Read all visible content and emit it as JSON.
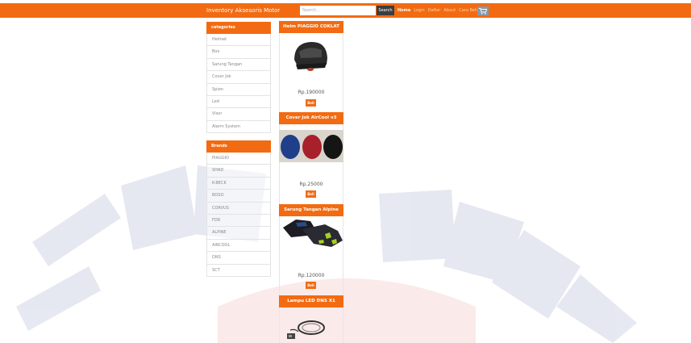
{
  "navbar": {
    "brand": "Inventory Aksesoris Motor",
    "search_placeholder": "Search...",
    "search_label": "Search",
    "links": [
      "Home",
      "Login",
      "Daftar",
      "About",
      "Cara Beli"
    ],
    "accent": "#f26b12"
  },
  "categories": {
    "title": "categories",
    "items": [
      "Helmet",
      "Box",
      "Sarung Tangan",
      "Cover Jok",
      "Spion",
      "Led",
      "Visor",
      "Alarm System"
    ]
  },
  "brands": {
    "title": "Brands",
    "items": [
      "PIAGGIO",
      "SHAD",
      "K-BECK",
      "BOSO",
      "CORVUS",
      "FDR",
      "ALPINE",
      "AIRCOOL",
      "DNS",
      "SCT"
    ]
  },
  "products": [
    {
      "name": "Helm PIAGGIO COKLAT",
      "price": "Rp.190000",
      "buy": "Beli"
    },
    {
      "name": "Cover Jok AirCool v3",
      "price": "Rp.25000",
      "buy": "Beli"
    },
    {
      "name": "Sarung Tangan Alpine",
      "price": "Rp.120000",
      "buy": "Beli"
    },
    {
      "name": "Lampu LED DNS X1",
      "price": "",
      "buy": ""
    }
  ]
}
